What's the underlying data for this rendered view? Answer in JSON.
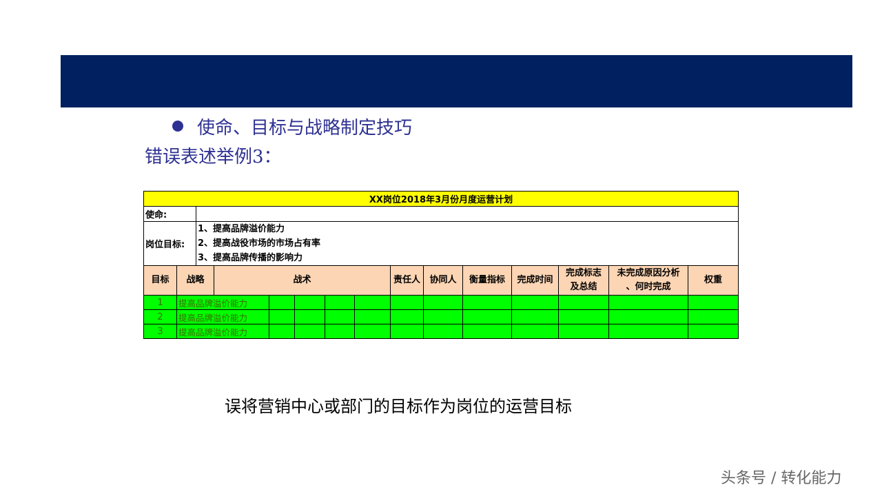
{
  "slide": {
    "bullet": "使命、目标与战略制定技巧",
    "subtitle": "错误表述举例3：",
    "caption": "误将营销中心或部门的目标作为岗位的运营目标",
    "watermark": "头条号 / 转化能力"
  },
  "table": {
    "title": "XX岗位2018年3月份月度运营计划",
    "mission_label": "使命:",
    "mission_value": "",
    "goal_label": "岗位目标:",
    "goals": [
      "1、提高品牌溢价能力",
      "2、提高战役市场的市场占有率",
      "3、提高品牌传播的影响力"
    ],
    "headers": {
      "goal": "目标",
      "strategy": "战略",
      "tactics": "战术",
      "owner": "责任人",
      "collaborator": "协同人",
      "metric": "衡量指标",
      "deadline": "完成时间",
      "done_flag_1": "完成标志",
      "done_flag_2": "及总结",
      "undone_1": "未完成原因分析",
      "undone_2": "、何时完成",
      "weight": "权重"
    },
    "rows": [
      {
        "index": "1",
        "strategy": "提高品牌溢价能力"
      },
      {
        "index": "2",
        "strategy": "提高品牌溢价能力"
      },
      {
        "index": "3",
        "strategy": "提高品牌溢价能力"
      }
    ]
  },
  "colors": {
    "banner": "#002060",
    "title_fill": "#ffff00",
    "header_fill": "#fcd5b4",
    "row_fill": "#00ff00",
    "heading_text": "#2e3192"
  }
}
